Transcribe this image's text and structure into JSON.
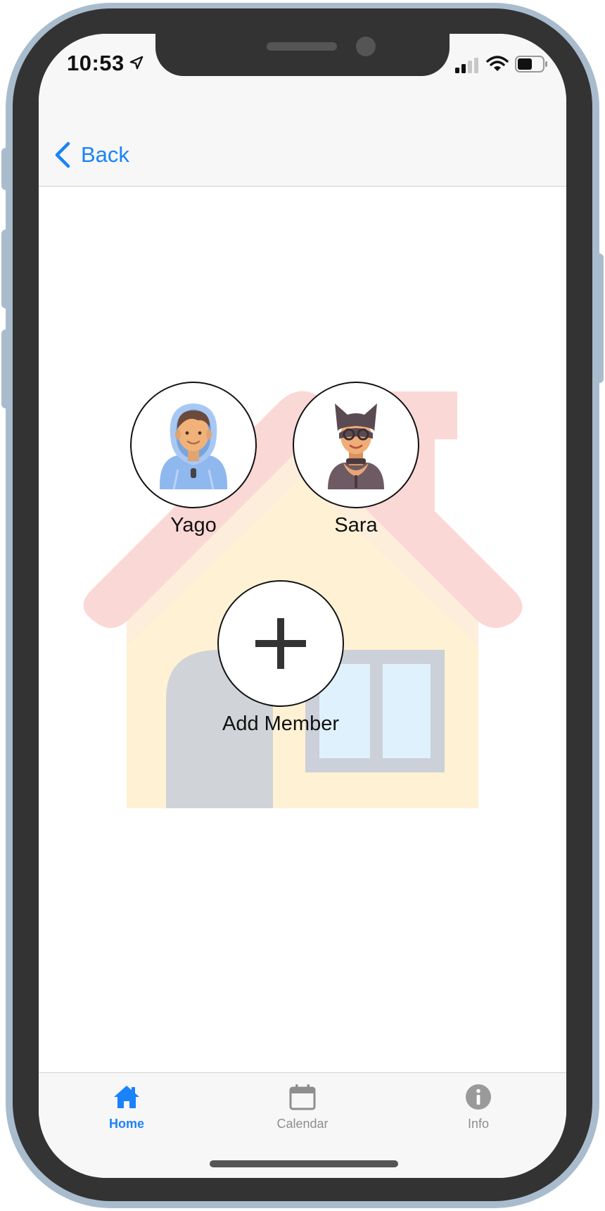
{
  "status_bar": {
    "time": "10:53"
  },
  "nav": {
    "back_label": "Back"
  },
  "members": [
    {
      "name": "Yago",
      "avatar": "boy-hoodie-avatar"
    },
    {
      "name": "Sara",
      "avatar": "catwoman-avatar"
    }
  ],
  "add_member": {
    "label": "Add Member"
  },
  "tabs": [
    {
      "label": "Home",
      "icon": "home-icon",
      "active": true
    },
    {
      "label": "Calendar",
      "icon": "calendar-icon",
      "active": false
    },
    {
      "label": "Info",
      "icon": "info-icon",
      "active": false
    }
  ],
  "colors": {
    "accent": "#1a82fb",
    "inactive_tab": "#8e8e8e",
    "house_roof": "#fad8d6",
    "house_wall": "#fff1d4"
  }
}
